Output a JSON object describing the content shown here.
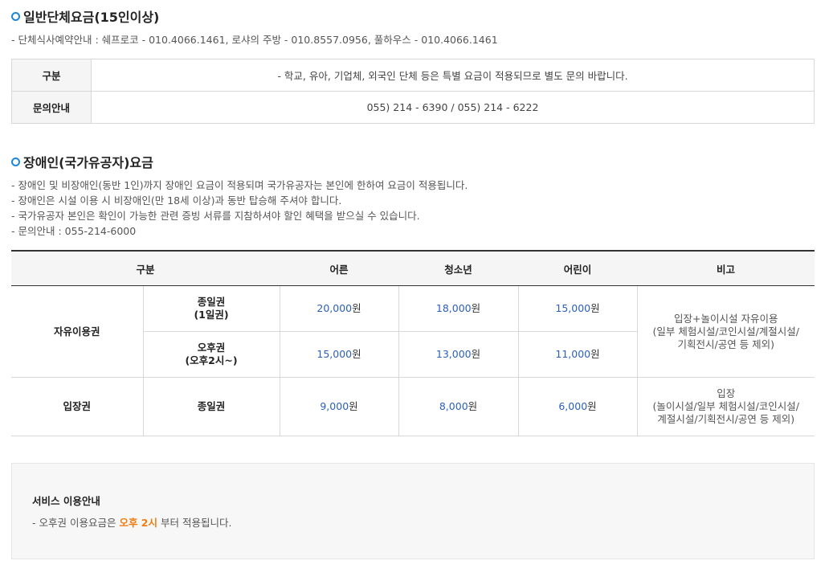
{
  "group": {
    "title": "일반단체요금(15인이상)",
    "info": "- 단체식사예약안내 : 쉐프로코 - 010.4066.1461, 로샤의 주방 - 010.8557.0956, 풀하우스 - 010.4066.1461",
    "rows": [
      {
        "label": "구분",
        "value": "- 학교, 유아, 기업체, 외국인 단체 등은 특별 요금이 적용되므로 별도 문의 바랍니다."
      },
      {
        "label": "문의안내",
        "value": "055) 214 - 6390 / 055) 214 - 6222"
      }
    ]
  },
  "disabled": {
    "title": "장애인(국가유공자)요금",
    "lines": [
      "- 장애인 및 비장애인(동반 1인)까지 장애인 요금이 적용되며 국가유공자는 본인에 한하여 요금이 적용됩니다.",
      "- 장애인은 시설 이용 시 비장애인(만 18세 이상)과 동반 탑승해 주셔야 합니다.",
      "- 국가유공자 본인은 확인이 가능한 관련 증빙 서류를 지참하셔야 할인 혜택을 받으실 수 있습니다.",
      "- 문의안내 : 055-214-6000"
    ],
    "headers": {
      "category": "구분",
      "adult": "어른",
      "youth": "청소년",
      "child": "어린이",
      "note": "비고"
    },
    "currency": "원",
    "free_use": {
      "label": "자유이용권",
      "note_line1": "입장+놀이시설 자유이용",
      "note_line2": "(일부 체험시설/코인시설/계절시설/",
      "note_line3": "기획전시/공연 등 제외)",
      "day": {
        "line1": "종일권",
        "line2": "(1일권)",
        "adult": "20,000",
        "youth": "18,000",
        "child": "15,000"
      },
      "afternoon": {
        "line1": "오후권",
        "line2": "(오후2시~)",
        "adult": "15,000",
        "youth": "13,000",
        "child": "11,000"
      }
    },
    "admission": {
      "label": "입장권",
      "type": "종일권",
      "adult": "9,000",
      "youth": "8,000",
      "child": "6,000",
      "note_line1": "입장",
      "note_line2": "(놀이시설/일부 체험시설/코인시설/",
      "note_line3": "계절시설/기획전시/공연 등 제외)"
    }
  },
  "service": {
    "title": "서비스 이용안내",
    "text_before": "- 오후권 이용요금은 ",
    "highlight": "오후 2시",
    "text_after": " 부터 적용됩니다.",
    "highlight_color": "#f07d14"
  }
}
